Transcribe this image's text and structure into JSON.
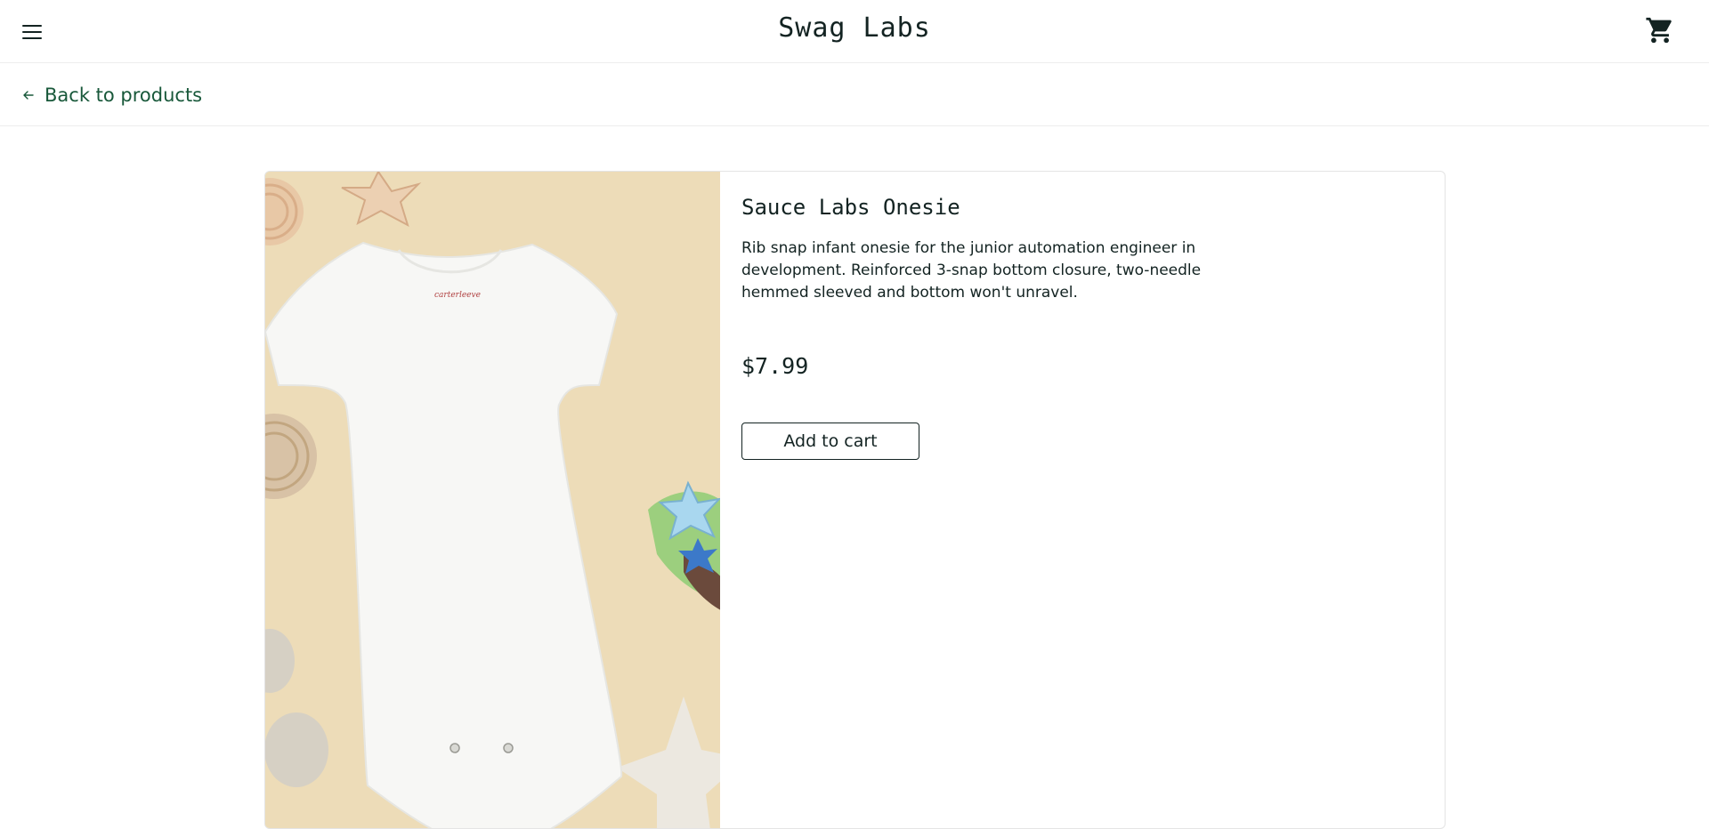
{
  "header": {
    "app_title": "Swag Labs",
    "menu_icon": "hamburger-menu-icon",
    "cart_icon": "shopping-cart-icon"
  },
  "secondary_header": {
    "back_label": "Back to products",
    "back_icon": "arrow-left-icon"
  },
  "product": {
    "name": "Sauce Labs Onesie",
    "description": "Rib snap infant onesie for the junior automation engineer in development. Reinforced 3-snap bottom closure, two-needle hemmed sleeved and bottom won't unravel.",
    "price": "$7.99",
    "add_to_cart_label": "Add to cart",
    "image_label": "carterleeve"
  },
  "colors": {
    "accent_green": "#18583a",
    "text_dark": "#132322",
    "image_background": "#eddcb8",
    "border": "#e4e4e4"
  }
}
